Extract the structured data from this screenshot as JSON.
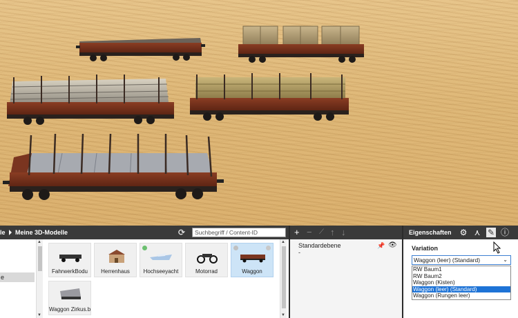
{
  "library": {
    "title_fragment": "le",
    "breadcrumb": "Meine 3D-Modelle",
    "search_placeholder": "Suchbegriff / Content-ID",
    "tree_selected_fragment": "e",
    "tiles": [
      {
        "label": "FahrwerkBodu",
        "selected": false,
        "badge": ""
      },
      {
        "label": "Herrenhaus",
        "selected": false,
        "badge": ""
      },
      {
        "label": "Hochseeyacht",
        "selected": false,
        "badge": "#6cc070"
      },
      {
        "label": "Motorrad",
        "selected": false,
        "badge": ""
      },
      {
        "label": "Waggon",
        "selected": true,
        "badge": "#c0c0c0"
      },
      {
        "label": "Waggon Zirkus.bl",
        "selected": false,
        "badge": ""
      }
    ]
  },
  "layers": {
    "toolbar": [
      "+",
      "−",
      "⟋",
      "↑",
      "↓"
    ],
    "row_name": "Standardebene",
    "row_sub": "-"
  },
  "properties": {
    "title": "Eigenschaften",
    "variation_label": "Variation",
    "selected_value": "Waggon (leer) (Standard)",
    "options": [
      {
        "label": "RW Baum1",
        "selected": false
      },
      {
        "label": "RW Baum2",
        "selected": false
      },
      {
        "label": "Waggon (Kisten)",
        "selected": false
      },
      {
        "label": "Waggon (leer) (Standard)",
        "selected": true
      },
      {
        "label": "Waggon (Rungen leer)",
        "selected": false
      }
    ]
  },
  "icons": {
    "refresh": "refresh-icon",
    "gear": "gear-icon",
    "nodes": "nodes-icon",
    "brush": "brush-icon",
    "info": "info-icon"
  }
}
